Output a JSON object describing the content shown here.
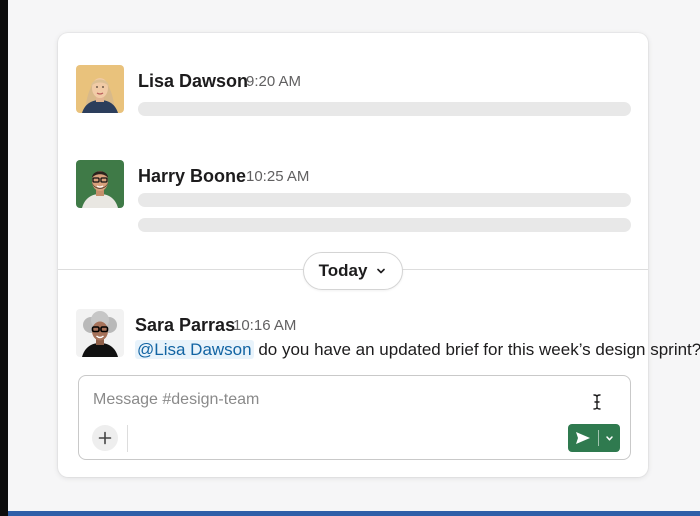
{
  "messages": [
    {
      "author": "Lisa Dawson",
      "time": "9:20 AM",
      "avatar_icon": "avatar-lisa-dawson"
    },
    {
      "author": "Harry Boone",
      "time": "10:25 AM",
      "avatar_icon": "avatar-harry-boone"
    },
    {
      "author": "Sara Parras",
      "time": "10:16 AM",
      "avatar_icon": "avatar-sara-parras",
      "mention": "@Lisa Dawson",
      "text": " do you have an updated brief for this week’s design sprint?"
    }
  ],
  "divider": {
    "label": "Today",
    "icon": "chevron-down-icon"
  },
  "composer": {
    "placeholder": "Message #design-team",
    "value": "",
    "attach_icon": "plus-icon",
    "send_icon": "send-icon",
    "send_menu_icon": "chevron-down-icon"
  },
  "colors": {
    "send_button": "#2f7a4f",
    "mention_bg": "#e8f3fb",
    "mention_text": "#1264a3",
    "skeleton": "#e8e8e8",
    "bottom_bar": "#2f5ea8"
  }
}
